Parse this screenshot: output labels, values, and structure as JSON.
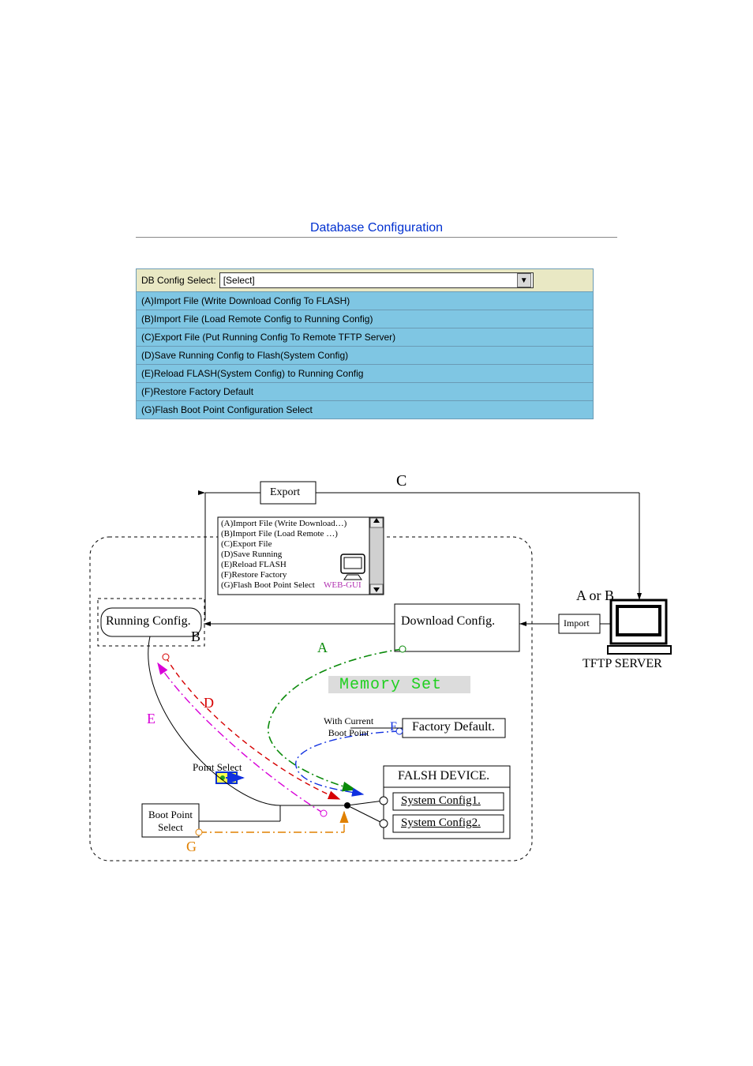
{
  "title": "Database Configuration",
  "select_label": "DB Config Select:",
  "select_value": "[Select]",
  "rows": {
    "a": "(A)Import File (Write Download Config To FLASH)",
    "b": "(B)Import File (Load Remote Config to Running Config)",
    "c": "(C)Export File (Put Running Config To Remote TFTP Server)",
    "d": "(D)Save Running Config to Flash(System Config)",
    "e": "(E)Reload FLASH(System Config) to Running Config",
    "f": "(F)Restore Factory Default",
    "g": "(G)Flash Boot Point Configuration Select"
  },
  "diagram": {
    "export_box": "Export",
    "import_box": "Import",
    "c_label": "C",
    "dropdown_lines": {
      "l1": "(A)Import File (Write Download…)",
      "l2": "(B)Import File (Load Remote …)",
      "l3": "(C)Export File",
      "l4": "(D)Save Running",
      "l5": "(E)Reload FLASH",
      "l6": "(F)Restore Factory",
      "l7": "(G)Flash Boot Point Select"
    },
    "web_gui": "WEB-GUI",
    "running_config": "Running Config.",
    "download_config": "Download Config.",
    "memory_set": "Memory Set",
    "factory_default": "Factory Default.",
    "flash_device": "FALSH DEVICE.",
    "sys1": "System Config1.",
    "sys2": "System Config2.",
    "tftp": "TFTP SERVER",
    "a_or_b": "A or B",
    "with_boot": "With Current\nBoot Point",
    "point_select": "Point Select",
    "boot_point_select": "Boot Point\nSelect",
    "lbl": {
      "A": "A",
      "B": "B",
      "C": "C",
      "D": "D",
      "E": "E",
      "F": "F",
      "G": "G"
    }
  }
}
